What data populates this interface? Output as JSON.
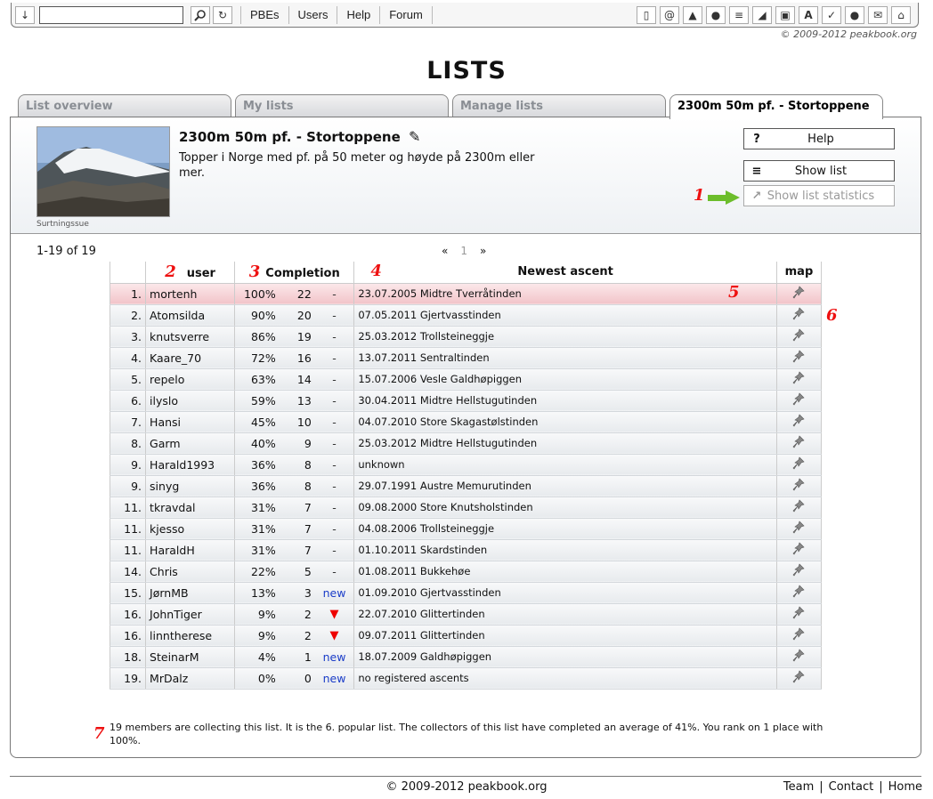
{
  "toolbar": {
    "nav": [
      "PBEs",
      "Users",
      "Help",
      "Forum"
    ],
    "search_value": ""
  },
  "copyright_top": "© 2009-2012 peakbook.org",
  "page_title": "LISTS",
  "tabs": [
    "List overview",
    "My lists",
    "Manage lists",
    "2300m 50m pf. - Stortoppene"
  ],
  "list": {
    "title": "2300m 50m pf. - Stortoppene",
    "description": "Topper i Norge med pf. på 50 meter og høyde på 2300m eller mer.",
    "photo_caption": "Surtningssue"
  },
  "buttons": {
    "help": "Help",
    "show_list": "Show list",
    "show_stats": "Show list statistics"
  },
  "annotations": [
    "1",
    "2",
    "3",
    "4",
    "5",
    "6",
    "7"
  ],
  "range_text": "1-19 of 19",
  "pager": {
    "prev": "«",
    "current": "1",
    "next": "»"
  },
  "table": {
    "headers": {
      "user": "user",
      "completion": "Completion",
      "newest": "Newest ascent",
      "map": "map"
    },
    "rows": [
      {
        "rank": "1.",
        "user": "mortenh",
        "pct": "100%",
        "count": "22",
        "change": "-",
        "ascent": "23.07.2005 Midtre Tverråtinden"
      },
      {
        "rank": "2.",
        "user": "Atomsilda",
        "pct": "90%",
        "count": "20",
        "change": "-",
        "ascent": "07.05.2011 Gjertvasstinden"
      },
      {
        "rank": "3.",
        "user": "knutsverre",
        "pct": "86%",
        "count": "19",
        "change": "-",
        "ascent": "25.03.2012 Trollsteineggje"
      },
      {
        "rank": "4.",
        "user": "Kaare_70",
        "pct": "72%",
        "count": "16",
        "change": "-",
        "ascent": "13.07.2011 Sentraltinden"
      },
      {
        "rank": "5.",
        "user": "repelo",
        "pct": "63%",
        "count": "14",
        "change": "-",
        "ascent": "15.07.2006 Vesle Galdhøpiggen"
      },
      {
        "rank": "6.",
        "user": "ilyslo",
        "pct": "59%",
        "count": "13",
        "change": "-",
        "ascent": "30.04.2011 Midtre Hellstugutinden"
      },
      {
        "rank": "7.",
        "user": "Hansi",
        "pct": "45%",
        "count": "10",
        "change": "-",
        "ascent": "04.07.2010 Store Skagastølstinden"
      },
      {
        "rank": "8.",
        "user": "Garm",
        "pct": "40%",
        "count": "9",
        "change": "-",
        "ascent": "25.03.2012 Midtre Hellstugutinden"
      },
      {
        "rank": "9.",
        "user": "Harald1993",
        "pct": "36%",
        "count": "8",
        "change": "-",
        "ascent": "unknown"
      },
      {
        "rank": "9.",
        "user": "sinyg",
        "pct": "36%",
        "count": "8",
        "change": "-",
        "ascent": "29.07.1991 Austre Memurutinden"
      },
      {
        "rank": "11.",
        "user": "tkravdal",
        "pct": "31%",
        "count": "7",
        "change": "-",
        "ascent": "09.08.2000 Store Knutsholstinden"
      },
      {
        "rank": "11.",
        "user": "kjesso",
        "pct": "31%",
        "count": "7",
        "change": "-",
        "ascent": "04.08.2006 Trollsteineggje"
      },
      {
        "rank": "11.",
        "user": "HaraldH",
        "pct": "31%",
        "count": "7",
        "change": "-",
        "ascent": "01.10.2011 Skardstinden"
      },
      {
        "rank": "14.",
        "user": "Chris",
        "pct": "22%",
        "count": "5",
        "change": "-",
        "ascent": "01.08.2011 Bukkehøe"
      },
      {
        "rank": "15.",
        "user": "JørnMB",
        "pct": "13%",
        "count": "3",
        "change": "new",
        "ascent": "01.09.2010 Gjertvasstinden"
      },
      {
        "rank": "16.",
        "user": "JohnTiger",
        "pct": "9%",
        "count": "2",
        "change": "down",
        "ascent": "22.07.2010 Glittertinden"
      },
      {
        "rank": "16.",
        "user": "linntherese",
        "pct": "9%",
        "count": "2",
        "change": "down",
        "ascent": "09.07.2011 Glittertinden"
      },
      {
        "rank": "18.",
        "user": "SteinarM",
        "pct": "4%",
        "count": "1",
        "change": "new",
        "ascent": "18.07.2009 Galdhøpiggen"
      },
      {
        "rank": "19.",
        "user": "MrDalz",
        "pct": "0%",
        "count": "0",
        "change": "new",
        "ascent": "no registered ascents"
      }
    ]
  },
  "summary": "19 members are collecting this list. It is the 6. popular list. The collectors of this list have completed an average of 41%. You rank on 1 place with 100%.",
  "footer": {
    "copyright": "© 2009-2012 peakbook.org",
    "links": [
      "Team",
      "Contact",
      "Home"
    ]
  }
}
